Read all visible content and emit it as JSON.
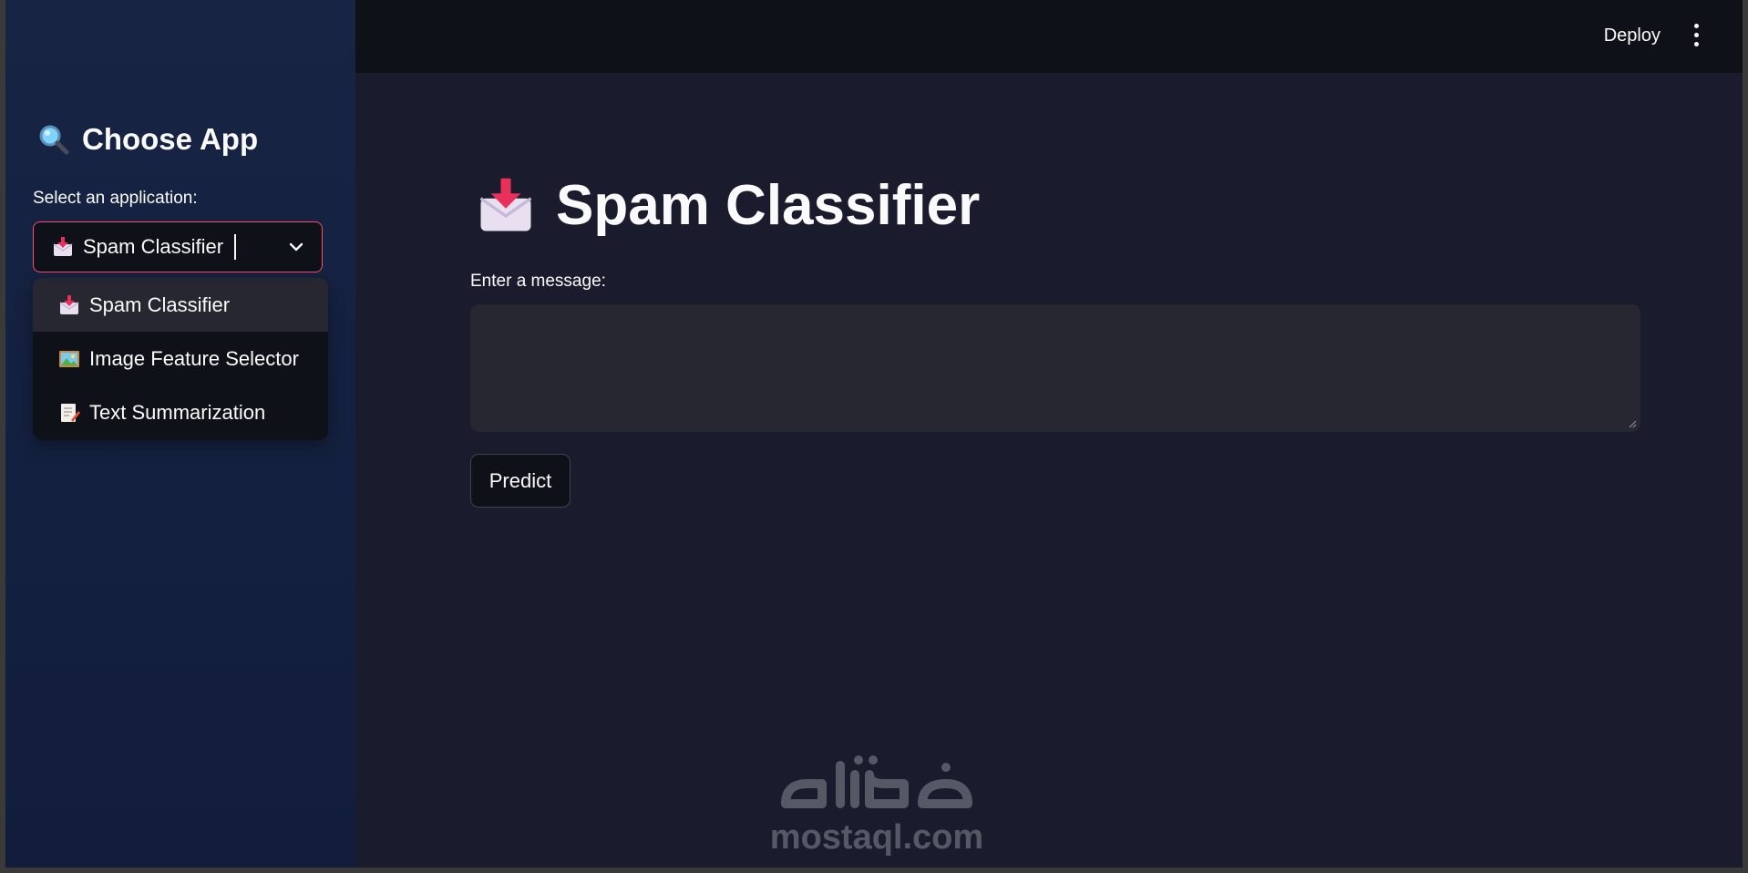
{
  "header": {
    "deploy_label": "Deploy"
  },
  "sidebar": {
    "title": "Choose App",
    "title_icon": "magnifier-icon",
    "select_label": "Select an application:",
    "selected_value": "Spam Classifier",
    "options": [
      {
        "label": "Spam Classifier",
        "icon": "inbox-tray-icon"
      },
      {
        "label": "Image Feature Selector",
        "icon": "framed-picture-icon"
      },
      {
        "label": "Text Summarization",
        "icon": "memo-icon"
      }
    ]
  },
  "main": {
    "title": "Spam Classifier",
    "title_icon": "inbox-tray-icon",
    "message_label": "Enter a message:",
    "message_value": "",
    "predict_label": "Predict"
  },
  "watermark": {
    "arabic_logo": "مستقل",
    "domain": "mostaql.com"
  },
  "colors": {
    "accent": "#ff4b6e",
    "background": "#1a1c2e",
    "sidebar": "#142140",
    "header": "#0e1117",
    "input": "#262730",
    "text": "#fafafa"
  }
}
